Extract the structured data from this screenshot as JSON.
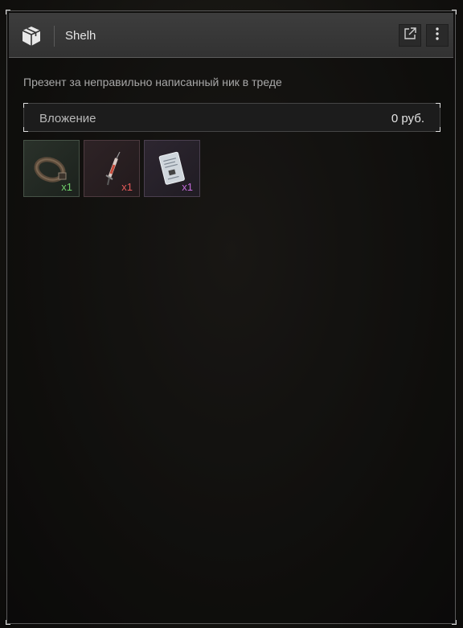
{
  "header": {
    "icon": "package-box-icon",
    "title": "Shelh",
    "buttons": [
      {
        "name": "open-external-icon"
      },
      {
        "name": "more-vertical-icon"
      }
    ]
  },
  "message": {
    "text": "Презент за неправильно написанный ник в треде"
  },
  "attachment": {
    "label": "Вложение",
    "value": "0 руб."
  },
  "items": [
    {
      "name": "belt-item",
      "icon": "belt-icon",
      "qty": "x1",
      "color": "#6fcf6a"
    },
    {
      "name": "syringe-item",
      "icon": "syringe-icon",
      "qty": "x1",
      "color": "#e35a5a"
    },
    {
      "name": "document-item",
      "icon": "document-icon",
      "qty": "x1",
      "color": "#c26bd8"
    }
  ]
}
